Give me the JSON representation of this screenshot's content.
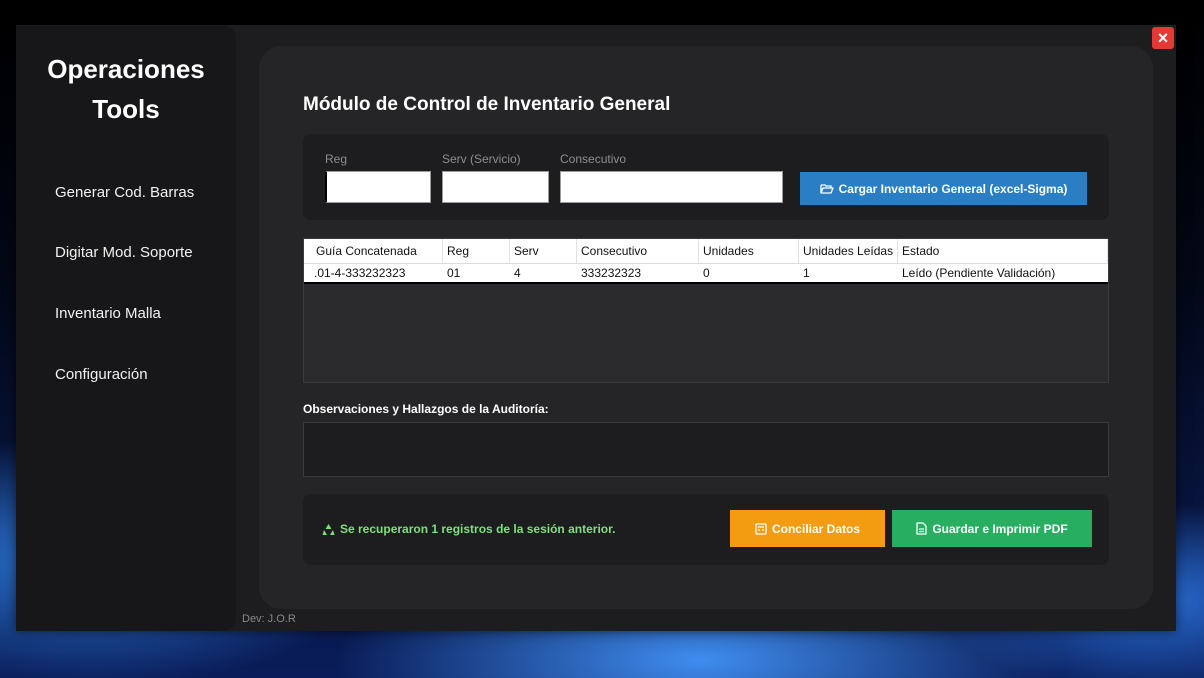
{
  "brand": {
    "line1": "Operaciones",
    "line2": "Tools"
  },
  "sidebar": {
    "items": [
      {
        "label": "Generar Cod. Barras"
      },
      {
        "label": "Digitar Mod. Soporte"
      },
      {
        "label": "Inventario Malla"
      },
      {
        "label": "Configuración"
      }
    ]
  },
  "footer_credit": "Dev: J.O.R",
  "window": {
    "close_label": "×"
  },
  "main": {
    "title": "Módulo de Control de Inventario General",
    "form": {
      "reg_label": "Reg",
      "reg_value": "",
      "serv_label": "Serv (Servicio)",
      "serv_value": "",
      "consec_label": "Consecutivo",
      "consec_value": "",
      "load_button": "Cargar Inventario General (excel-Sigma)"
    },
    "table": {
      "columns": [
        "Guía Concatenada",
        "Reg",
        "Serv",
        "Consecutivo",
        "Unidades",
        "Unidades Leídas",
        "Estado"
      ],
      "rows": [
        [
          ".01-4-333232323",
          "01",
          "4",
          "333232323",
          "0",
          "1",
          "Leído (Pendiente Validación)"
        ]
      ]
    },
    "observations_label": "Observaciones y Hallazgos de la Auditoría:",
    "observations_value": "",
    "status_text": "Se recuperaron 1 registros de la sesión anterior.",
    "reconcile_button": "Conciliar Datos",
    "save_button": "Guardar e Imprimir PDF"
  },
  "icons": {
    "load": "folder-open-icon",
    "status": "recycle-icon",
    "reconcile": "calculator-icon",
    "save": "file-icon",
    "close": "close-icon"
  },
  "colors": {
    "accent_blue": "#2a7fc4",
    "accent_orange": "#f39c12",
    "accent_green": "#27ae60",
    "status_green": "#7de07d",
    "close_red": "#e53935"
  }
}
